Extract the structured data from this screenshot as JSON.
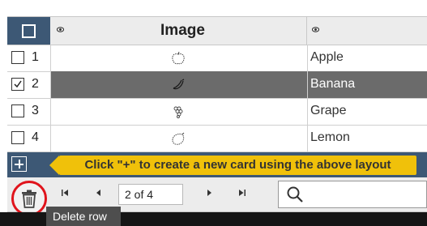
{
  "header": {
    "column_image": "Image"
  },
  "rows": [
    {
      "number": "1",
      "name": "Apple",
      "checked": false,
      "icon": "apple-icon"
    },
    {
      "number": "2",
      "name": "Banana",
      "checked": true,
      "icon": "banana-icon"
    },
    {
      "number": "3",
      "name": "Grape",
      "checked": false,
      "icon": "grape-icon"
    },
    {
      "number": "4",
      "name": "Lemon",
      "checked": false,
      "icon": "lemon-icon"
    }
  ],
  "banner": {
    "text": "Click \"+\" to create a new card using the above layout"
  },
  "pager": {
    "first": "⏮",
    "prev": "◀",
    "page_text": "2 of 4",
    "next": "▶",
    "last": "⏭"
  },
  "tooltip": {
    "text": "Delete row"
  },
  "colors": {
    "header_accent": "#3d5875",
    "selected_row": "#6b6b6b",
    "banner": "#f0c10a",
    "highlight_ring": "#e0141c"
  }
}
